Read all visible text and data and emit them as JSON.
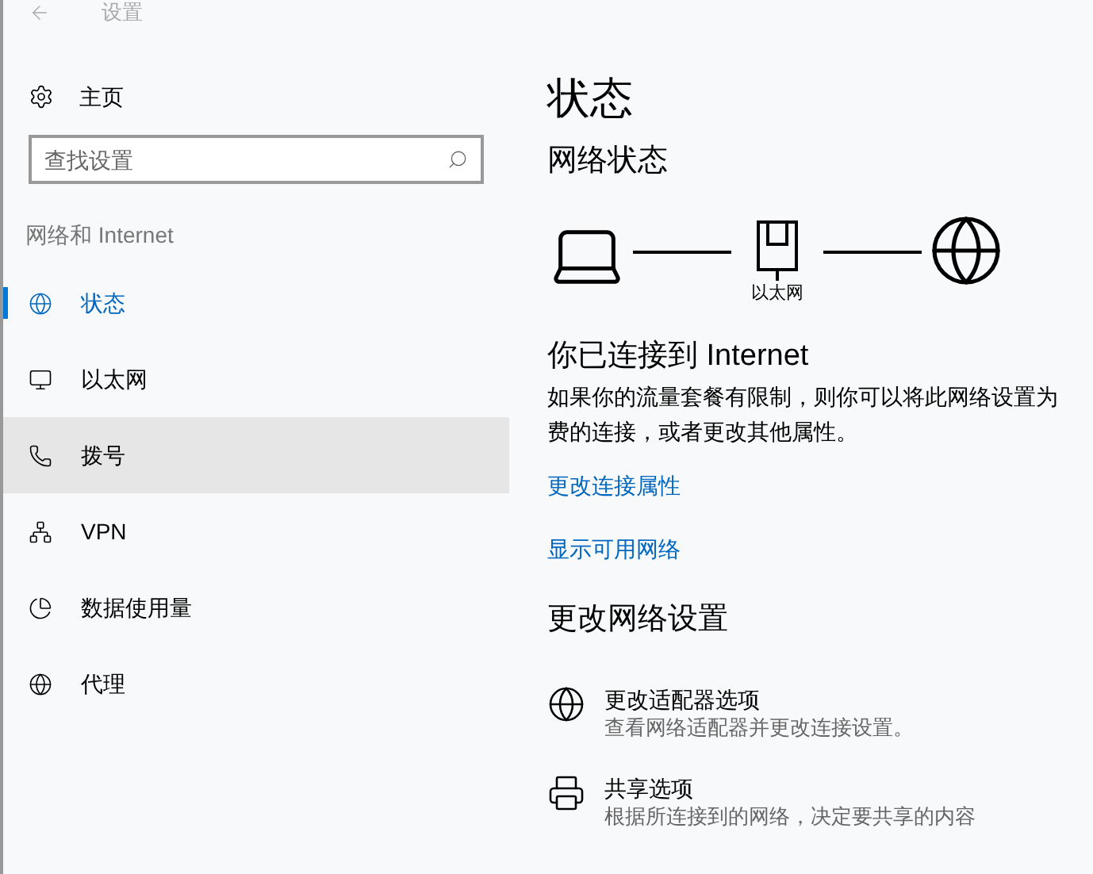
{
  "window": {
    "title": "设置"
  },
  "sidebar": {
    "home": "主页",
    "search": {
      "placeholder": "查找设置"
    },
    "section": "网络和 Internet",
    "items": [
      {
        "label": "状态",
        "kind": "status",
        "selected": true,
        "hovered": false
      },
      {
        "label": "以太网",
        "kind": "ethernet",
        "selected": false,
        "hovered": false
      },
      {
        "label": "拨号",
        "kind": "dialup",
        "selected": false,
        "hovered": true
      },
      {
        "label": "VPN",
        "kind": "vpn",
        "selected": false,
        "hovered": false
      },
      {
        "label": "数据使用量",
        "kind": "data",
        "selected": false,
        "hovered": false
      },
      {
        "label": "代理",
        "kind": "proxy",
        "selected": false,
        "hovered": false
      }
    ]
  },
  "main": {
    "title": "状态",
    "network_status": "网络状态",
    "diagram_label": "以太网",
    "connected": "你已连接到 Internet",
    "description": [
      "如果你的流量套餐有限制，则你可以将此网络设置为",
      "费的连接，或者更改其他属性。"
    ],
    "links": [
      "更改连接属性",
      "显示可用网络"
    ],
    "change_heading": "更改网络设置",
    "options": [
      {
        "kind": "adapter",
        "title": "更改适配器选项",
        "subtitle": "查看网络适配器并更改连接设置。"
      },
      {
        "kind": "sharing",
        "title": "共享选项",
        "subtitle": "根据所连接到的网络，决定要共享的内容"
      }
    ]
  }
}
